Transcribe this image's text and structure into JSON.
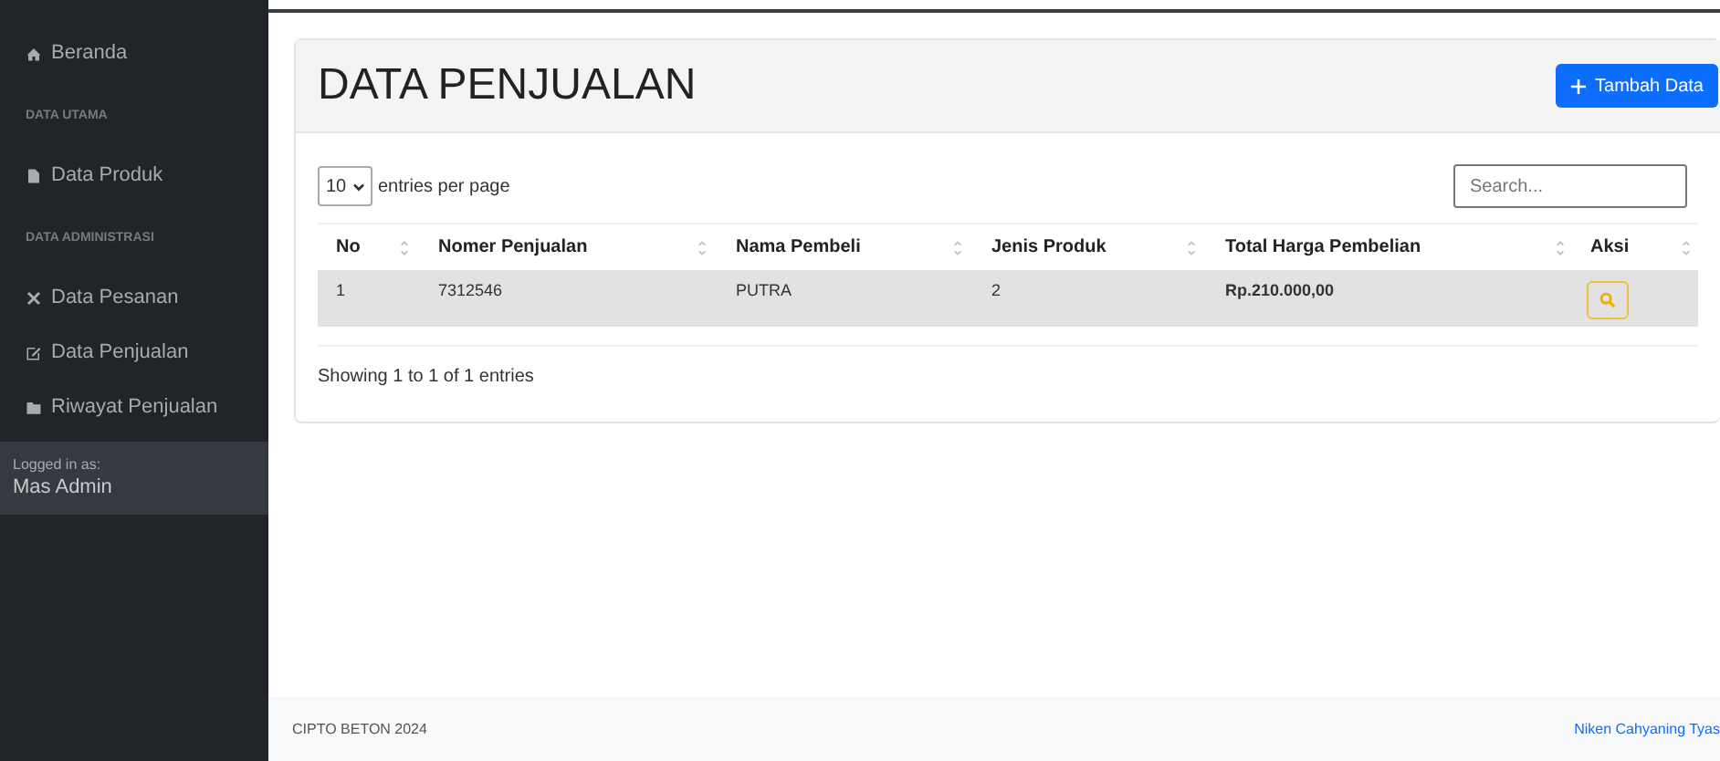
{
  "sidebar": {
    "items": [
      {
        "kind": "link",
        "label": "Beranda"
      },
      {
        "kind": "heading",
        "label": "DATA UTAMA"
      },
      {
        "kind": "link",
        "label": "Data Produk"
      },
      {
        "kind": "heading",
        "label": "DATA ADMINISTRASI"
      },
      {
        "kind": "link",
        "label": "Data Pesanan"
      },
      {
        "kind": "link",
        "label": "Data Penjualan"
      },
      {
        "kind": "link",
        "label": "Riwayat Penjualan"
      }
    ],
    "footer": {
      "caption": "Logged in as:",
      "user": "Mas Admin"
    }
  },
  "page": {
    "title": "DATA PENJUALAN",
    "add_button": "Tambah Data"
  },
  "table": {
    "entries_select": "10",
    "entries_label": "entries per page",
    "search": {
      "placeholder": "Search..."
    },
    "columns": [
      "No",
      "Nomer Penjualan",
      "Nama Pembeli",
      "Jenis Produk",
      "Total Harga Pembelian",
      "Aksi"
    ],
    "rows": [
      {
        "cells": [
          "1",
          "7312546",
          "PUTRA",
          "2",
          "Rp.210.000,00"
        ]
      }
    ],
    "info": "Showing 1 to 1 of 1 entries"
  },
  "footer": {
    "left": "CIPTO BETON 2024",
    "right": "Niken Cahyaning Tyas"
  }
}
